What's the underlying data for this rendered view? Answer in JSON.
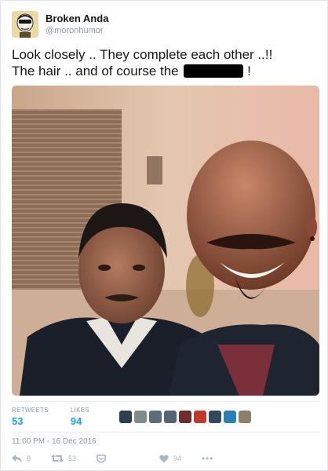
{
  "user": {
    "display_name": "Broken Anda",
    "handle": "@moronhumor"
  },
  "tweet": {
    "line1": "Look closely .. They complete each other ..!!",
    "line2_before": "The hair .. and of course the",
    "line2_after": "!"
  },
  "stats": {
    "retweets_label": "RETWEETS",
    "retweets_value": "53",
    "likes_label": "LIKES",
    "likes_value": "94"
  },
  "timestamp": "11:00 PM - 16 Dec 2016",
  "actions": {
    "reply_count": "8",
    "retweet_count": "53",
    "like_count": "94"
  },
  "colors": {
    "accent": "#1da1f2",
    "muted": "#8899a6"
  },
  "icons": [
    "reply-icon",
    "retweet-icon",
    "dm-icon",
    "heart-icon",
    "more-icon"
  ]
}
